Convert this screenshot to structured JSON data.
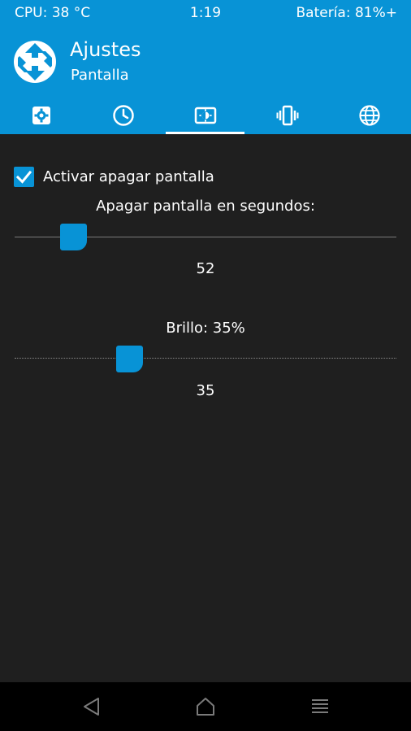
{
  "status_bar": {
    "cpu": "CPU: 38 °C",
    "time": "1:19",
    "battery": "Batería: 81%+"
  },
  "header": {
    "title": "Ajustes",
    "subtitle": "Pantalla",
    "logo_icon": "twrp-logo-icon",
    "background_color": "#0893d6"
  },
  "tabs": [
    {
      "icon": "gear-icon",
      "selected": false
    },
    {
      "icon": "clock-icon",
      "selected": false
    },
    {
      "icon": "brightness-icon",
      "selected": true
    },
    {
      "icon": "vibration-icon",
      "selected": false
    },
    {
      "icon": "globe-icon",
      "selected": false
    }
  ],
  "screen_timeout": {
    "checkbox_label": "Activar apagar pantalla",
    "checked": true,
    "slider_label": "Apagar pantalla en segundos:",
    "value": "52",
    "slider_fraction": 0.155
  },
  "brightness": {
    "slider_label": "Brillo: 35%",
    "value": "35",
    "slider_fraction": 0.3
  },
  "nav_bar": {
    "back_icon": "back-triangle-icon",
    "home_icon": "home-icon",
    "menu_icon": "menu-lines-icon"
  },
  "colors": {
    "accent": "#0893d6",
    "background": "#1f1f1f",
    "nav_background": "#000000"
  }
}
